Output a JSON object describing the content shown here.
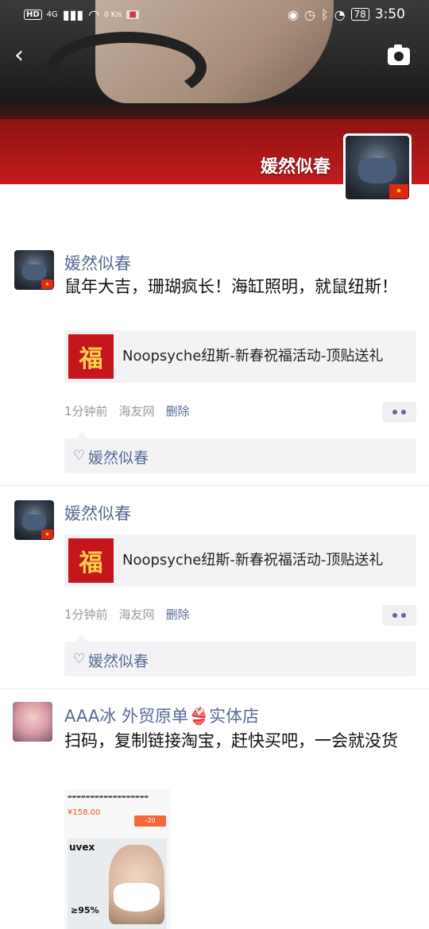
{
  "status_bar": {
    "hd": "HD",
    "net": "4G",
    "speed": "0 K/s",
    "battery": "78",
    "time": "3:50"
  },
  "cover": {
    "username": "媛然似春"
  },
  "posts": [
    {
      "name": "媛然似春",
      "text": "鼠年大吉，珊瑚疯长！海缸照明，就鼠纽斯！",
      "link_title": "Noopsyche纽斯-新春祝福活动-顶贴送礼",
      "link_thumb": "福",
      "time": "1分钟前",
      "source": "海友网",
      "delete": "删除",
      "liker": "媛然似春"
    },
    {
      "name": "媛然似春",
      "text": "",
      "link_title": "Noopsyche纽斯-新春祝福活动-顶贴送礼",
      "link_thumb": "福",
      "time": "1分钟前",
      "source": "海友网",
      "delete": "删除",
      "liker": "媛然似春"
    },
    {
      "name": "AAA冰  外贸原单👙实体店",
      "text": "扫码，复制链接淘宝，赶快买吧，一会就没货",
      "ad": {
        "price": "¥158.00",
        "coupon": "-20",
        "brand": "uvex",
        "pct": "≥95%"
      }
    }
  ],
  "colors": {
    "link_blue": "#576b95",
    "cover_red": "#c41b1b"
  }
}
